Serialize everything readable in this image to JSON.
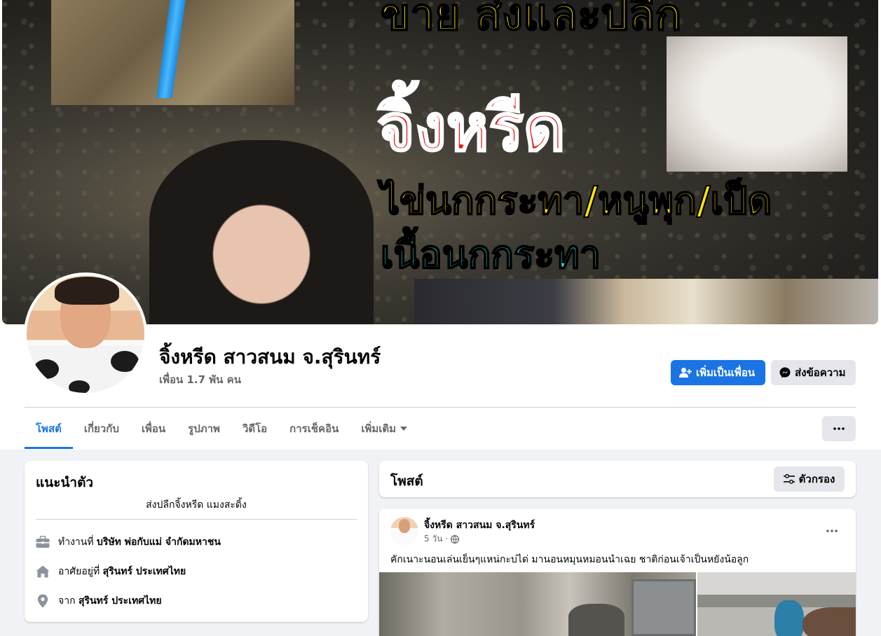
{
  "cover": {
    "line1": "ขาย ส่งและปลีก",
    "line2": "จิ้งหรีด",
    "line3": "ไข่นกกระทา/หนูพุก/เป็ด",
    "line4": "เนื้อนกกระทา"
  },
  "profile": {
    "name": "จิ้งหรีด สาวสนม จ.สุรินทร์",
    "friends": "เพื่อน 1.7 พัน คน",
    "add_friend_label": "เพิ่มเป็นเพื่อน",
    "message_label": "ส่งข้อความ"
  },
  "tabs": [
    {
      "label": "โพสต์"
    },
    {
      "label": "เกี่ยวกับ"
    },
    {
      "label": "เพื่อน"
    },
    {
      "label": "รูปภาพ"
    },
    {
      "label": "วิดีโอ"
    },
    {
      "label": "การเช็คอิน"
    },
    {
      "label": "เพิ่มเติม"
    }
  ],
  "intro": {
    "title": "แนะนำตัว",
    "bio": "ส่งปลีกจิ้งหรีด แมงสะดิ้ง",
    "work_prefix": "ทำงานที่",
    "work_value": "บริษัท พ่อกับแม่ จำกัดมหาชน",
    "lives_prefix": "อาศัยอยู่ที่",
    "lives_value": "สุรินทร์ ประเทศไทย",
    "from_prefix": "จาก",
    "from_value": "สุรินทร์ ประเทศไทย"
  },
  "posts": {
    "title": "โพสต์",
    "filter_label": "ตัวกรอง"
  },
  "post": {
    "author": "จิ้งหรีด สาวสนม จ.สุรินทร์",
    "time": "5 วัน ·",
    "text": "คักเนาะนอนเล่นเย็นๆแหน่กะบ่ได่  มานอนหมุนหมอนนำเฉย ชาติก่อนเจ้าเป็นหยังน้อลูก"
  },
  "colors": {
    "accent": "#1b74e4",
    "secondary_button": "#e4e6eb",
    "background": "#f0f2f5",
    "muted_text": "#65676b"
  }
}
